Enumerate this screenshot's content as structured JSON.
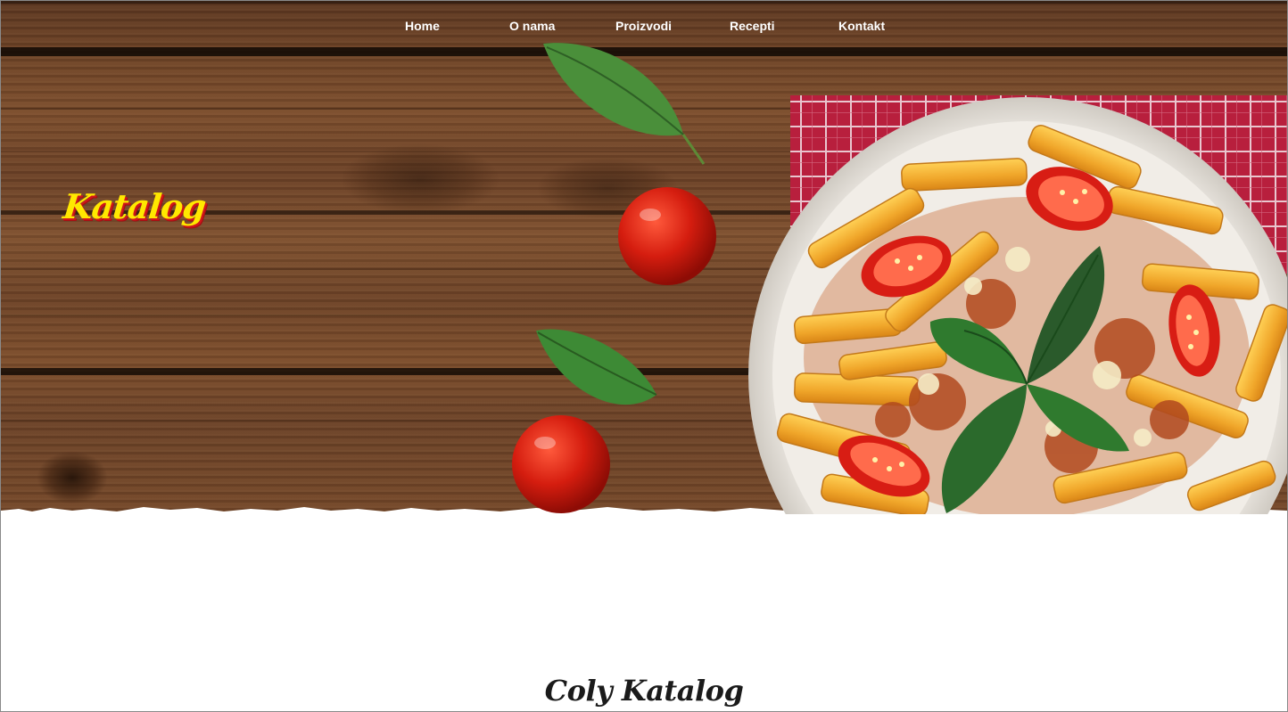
{
  "nav": {
    "items": [
      {
        "label": "Home"
      },
      {
        "label": "O nama"
      },
      {
        "label": "Proizvodi"
      },
      {
        "label": "Recepti"
      },
      {
        "label": "Kontakt"
      }
    ]
  },
  "hero": {
    "logo_text": "Katalog"
  },
  "section": {
    "title": "Coly Katalog"
  },
  "colors": {
    "logo_yellow": "#ffe800",
    "logo_red": "#d0161b",
    "wood": "#6f4427",
    "napkin": "#c2284a"
  },
  "icons": {
    "hero_image": "pasta-plate-illustration"
  }
}
